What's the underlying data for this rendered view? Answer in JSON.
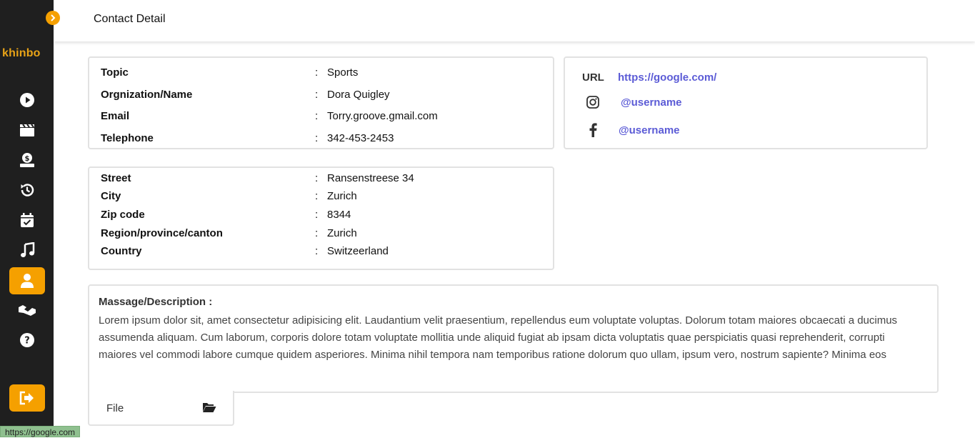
{
  "sidebar": {
    "logo": "khinbo",
    "items": [
      {
        "icon": "play-circle-icon"
      },
      {
        "icon": "clapperboard-icon"
      },
      {
        "icon": "money-hand-icon"
      },
      {
        "icon": "history-icon"
      },
      {
        "icon": "calendar-check-icon"
      },
      {
        "icon": "music-icon"
      },
      {
        "icon": "user-icon",
        "active": true
      },
      {
        "icon": "handshake-icon"
      },
      {
        "icon": "help-icon"
      }
    ],
    "logout_icon": "logout-icon"
  },
  "header": {
    "title": "Contact Detail"
  },
  "contact": {
    "rows": [
      {
        "label": "Topic",
        "sep": ":",
        "value": "Sports"
      },
      {
        "label": "Orgnization/Name",
        "sep": ":",
        "value": "Dora Quigley"
      },
      {
        "label": "Email",
        "sep": ":",
        "value": "Torry.groove.gmail.com"
      },
      {
        "label": "Telephone",
        "sep": ":",
        "value": "342-453-2453"
      }
    ]
  },
  "social": {
    "url_label": "URL",
    "url": "https://google.com/",
    "instagram": "@username",
    "facebook": "@username"
  },
  "address": {
    "rows": [
      {
        "label": "Street",
        "sep": ":",
        "value": "Ransenstreese 34"
      },
      {
        "label": "City",
        "sep": ":",
        "value": "Zurich"
      },
      {
        "label": "Zip code",
        "sep": ":",
        "value": "8344"
      },
      {
        "label": "Region/province/canton",
        "sep": ":",
        "value": "Zurich"
      },
      {
        "label": "Country",
        "sep": ":",
        "value": "Switzeerland"
      }
    ]
  },
  "description": {
    "title": "Massage/Description :",
    "body": "Lorem ipsum dolor sit, amet consectetur adipisicing elit. Laudantium velit praesentium, repellendus eum voluptate voluptas. Dolorum totam maiores obcaecati a ducimus assumenda aliquam. Cum laborum, corporis dolore totam voluptate mollitia unde aliquid fugiat ab ipsam dicta voluptatis quae perspiciatis quasi reprehenderit, corrupti maiores vel commodi labore cumque quidem asperiores. Minima nihil tempora nam temporibus ratione dolorum quo ullam, ipsum vero, nostrum sapiente? Minima eos"
  },
  "file": {
    "label": "File"
  },
  "status_bar": {
    "text": "https://google.com"
  },
  "colors": {
    "accent": "#f5a000",
    "sidebar_bg": "#1f1f1f",
    "link": "#5b5bd6"
  }
}
